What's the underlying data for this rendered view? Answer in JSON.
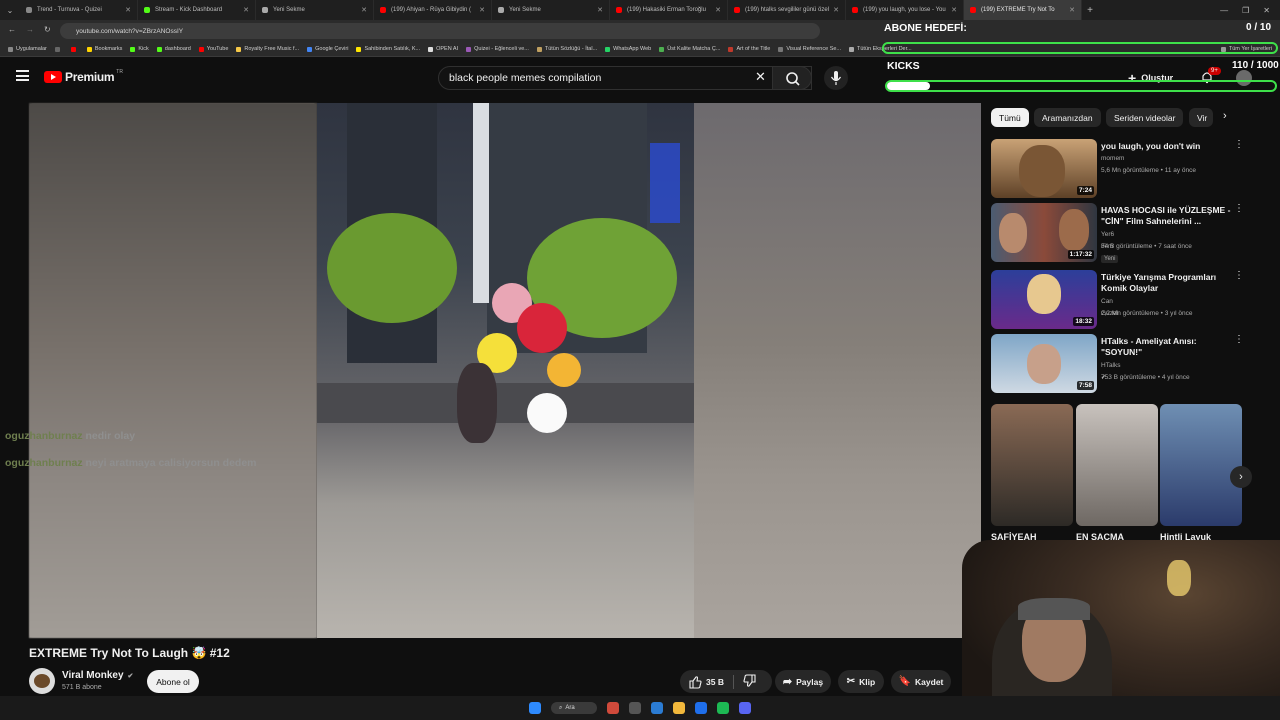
{
  "browser": {
    "tabs": [
      {
        "label": "Trend - Turnuva - Quizei",
        "color": "#888"
      },
      {
        "label": "Stream - Kick Dashboard",
        "color": "#53fc18"
      },
      {
        "label": "Yeni Sekme",
        "color": "#aaa"
      },
      {
        "label": "(199) Ahiyan - Rüya Gibiydin (",
        "color": "#ff0000"
      },
      {
        "label": "Yeni Sekme",
        "color": "#aaa"
      },
      {
        "label": "(199) Hakasiki Erman Toroğlu",
        "color": "#ff0000"
      },
      {
        "label": "(199) htalks sevgililer günü özel",
        "color": "#ff0000"
      },
      {
        "label": "(199) you laugh, you lose - You",
        "color": "#ff0000"
      },
      {
        "label": "(199) EXTREME Try Not To",
        "color": "#ff0000"
      }
    ],
    "url": "youtube.com/watch?v=ZBrzANOssIY",
    "bookmarks": [
      "Uygulamalar",
      "Bookmarks",
      "Kick",
      "dashboard",
      "YouTube",
      "Royalty Free Music f...",
      "Google Çeviri",
      "Sahibinden Satılık, K...",
      "OPEN AI",
      "Quizei - Eğlenceli ve...",
      "Tütün Sözlüğü - İtal...",
      "WhatsApp Web",
      "Üst Kalite Matcha Ç...",
      "Art of the Title",
      "Visual Reference Se...",
      "Tütün Eksperleri Der..."
    ],
    "all_bookmarks": "Tüm Yer İşaretleri"
  },
  "youtube": {
    "logo": "Premium",
    "logo_sup": "TR",
    "search_value": "black people memes compilation",
    "create_label": "Oluştur",
    "notif_badge": "9+"
  },
  "video": {
    "title": "EXTREME Try Not To Laugh 🤯 #12",
    "channel": "Viral Monkey",
    "subs": "571 B abone",
    "subscribe": "Abone ol",
    "likes": "35 B",
    "share": "Paylaş",
    "clip": "Klip",
    "save": "Kaydet"
  },
  "chat": [
    {
      "user": "oguzhanburnaz",
      "msg": "nedir olay"
    },
    {
      "user": "oguzhanburnaz",
      "msg": "neyi aratmaya calisiyorsun dedem"
    }
  ],
  "sidebar": {
    "chips": [
      "Tümü",
      "Aramanızdan",
      "Seriden videolar",
      "Vir"
    ],
    "videos": [
      {
        "title": "you laugh, you don't win",
        "channel": "momem",
        "meta": "5,6 Mn görüntüleme • 11 ay önce",
        "duration": "7:24",
        "badge": ""
      },
      {
        "title": "HAVAS HOCASI ile YÜZLEŞME - \"CİN\" Film Sahnelerini ...",
        "channel": "Yer6 Film",
        "meta": "34 B görüntüleme • 7 saat önce",
        "duration": "1:17:32",
        "badge": "Yeni"
      },
      {
        "title": "Türkiye Yarışma Programları Komik Olaylar",
        "channel": "Can Guzel",
        "meta": "2,2 Mn görüntüleme • 3 yıl önce",
        "duration": "18:32",
        "badge": ""
      },
      {
        "title": "HTalks - Ameliyat Anısı: \"SOYUN!\"",
        "channel": "HTalks",
        "meta": "753 B görüntüleme • 4 yıl önce",
        "duration": "7:58",
        "badge": ""
      }
    ],
    "shorts": [
      "SAFİYEAH",
      "EN SACMA",
      "Hintli Layuk"
    ]
  },
  "overlay": {
    "goal_label": "ABONE HEDEFİ:",
    "goal_count": "0 / 10",
    "kicks_label": "KICKS",
    "kicks_count": "110 / 1000",
    "kicks_progress": 0.11
  },
  "taskbar": {
    "search_label": "Ara"
  }
}
